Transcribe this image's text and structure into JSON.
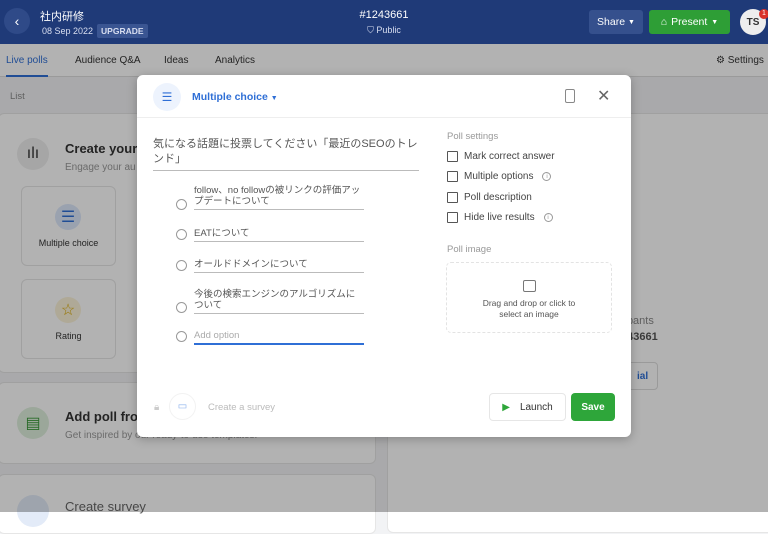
{
  "header": {
    "event_name": "社内研修",
    "date": "08 Sep 2022",
    "upgrade": "UPGRADE",
    "event_code": "#1243661",
    "visibility": "Public",
    "share": "Share",
    "present": "Present",
    "avatar_initials": "TS",
    "notification_count": "1"
  },
  "tabs": [
    {
      "label": "Live polls",
      "active": true
    },
    {
      "label": "Audience Q&A"
    },
    {
      "label": "Ideas"
    },
    {
      "label": "Analytics"
    }
  ],
  "settings": "Settings",
  "list_label": "List",
  "background": {
    "create_title": "Create your",
    "create_sub": "Engage your au",
    "types": [
      "Multiple choice",
      "Rating"
    ],
    "template_title": "Add poll fro",
    "template_sub": "Get inspired by our ready-to-use templates.",
    "survey_title": "Create survey",
    "right_title": "e",
    "right_sub": "cipants",
    "right_code": "243661",
    "right_button": "ial"
  },
  "modal": {
    "type_label": "Multiple choice",
    "question": "気になる話題に投票してください「最近のSEOのトレンド」",
    "options": [
      "follow、no followの被リンクの評価アップデートについて",
      "EATについて",
      "オールドドメインについて",
      "今後の検索エンジンのアルゴリズムについて"
    ],
    "add_option_placeholder": "Add option",
    "poll_settings_title": "Poll settings",
    "settings": [
      {
        "label": "Mark correct answer",
        "checked": false
      },
      {
        "label": "Multiple options",
        "checked": false,
        "info": true
      },
      {
        "label": "Poll description",
        "checked": false
      },
      {
        "label": "Hide live results",
        "checked": false,
        "info": true
      }
    ],
    "poll_image_title": "Poll image",
    "poll_image_hint": "Drag and drop or click to select an image",
    "create_survey": "Create a survey",
    "launch": "Launch",
    "save": "Save"
  },
  "colors": {
    "header": "#1f3a78",
    "accent": "#2f6fd6",
    "green": "#2ea63a"
  }
}
